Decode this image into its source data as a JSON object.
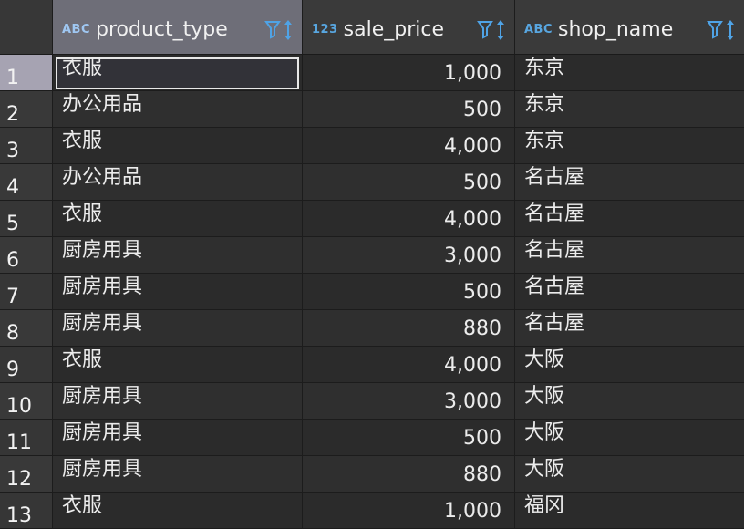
{
  "columns": [
    {
      "type_badge": "ABC",
      "name": "product_type",
      "icon": "filter-sort-icon"
    },
    {
      "type_badge": "123",
      "name": "sale_price",
      "icon": "filter-sort-icon"
    },
    {
      "type_badge": "ABC",
      "name": "shop_name",
      "icon": "filter-sort-icon"
    }
  ],
  "accent_color": "#58a6e0",
  "rows": [
    {
      "n": "1",
      "product_type": "衣服",
      "sale_price": "1,000",
      "shop_name": "东京"
    },
    {
      "n": "2",
      "product_type": "办公用品",
      "sale_price": "500",
      "shop_name": "东京"
    },
    {
      "n": "3",
      "product_type": "衣服",
      "sale_price": "4,000",
      "shop_name": "东京"
    },
    {
      "n": "4",
      "product_type": "办公用品",
      "sale_price": "500",
      "shop_name": "名古屋"
    },
    {
      "n": "5",
      "product_type": "衣服",
      "sale_price": "4,000",
      "shop_name": "名古屋"
    },
    {
      "n": "6",
      "product_type": "厨房用具",
      "sale_price": "3,000",
      "shop_name": "名古屋"
    },
    {
      "n": "7",
      "product_type": "厨房用具",
      "sale_price": "500",
      "shop_name": "名古屋"
    },
    {
      "n": "8",
      "product_type": "厨房用具",
      "sale_price": "880",
      "shop_name": "名古屋"
    },
    {
      "n": "9",
      "product_type": "衣服",
      "sale_price": "4,000",
      "shop_name": "大阪"
    },
    {
      "n": "10",
      "product_type": "厨房用具",
      "sale_price": "3,000",
      "shop_name": "大阪"
    },
    {
      "n": "11",
      "product_type": "厨房用具",
      "sale_price": "500",
      "shop_name": "大阪"
    },
    {
      "n": "12",
      "product_type": "厨房用具",
      "sale_price": "880",
      "shop_name": "大阪"
    },
    {
      "n": "13",
      "product_type": "衣服",
      "sale_price": "1,000",
      "shop_name": "福冈"
    }
  ]
}
